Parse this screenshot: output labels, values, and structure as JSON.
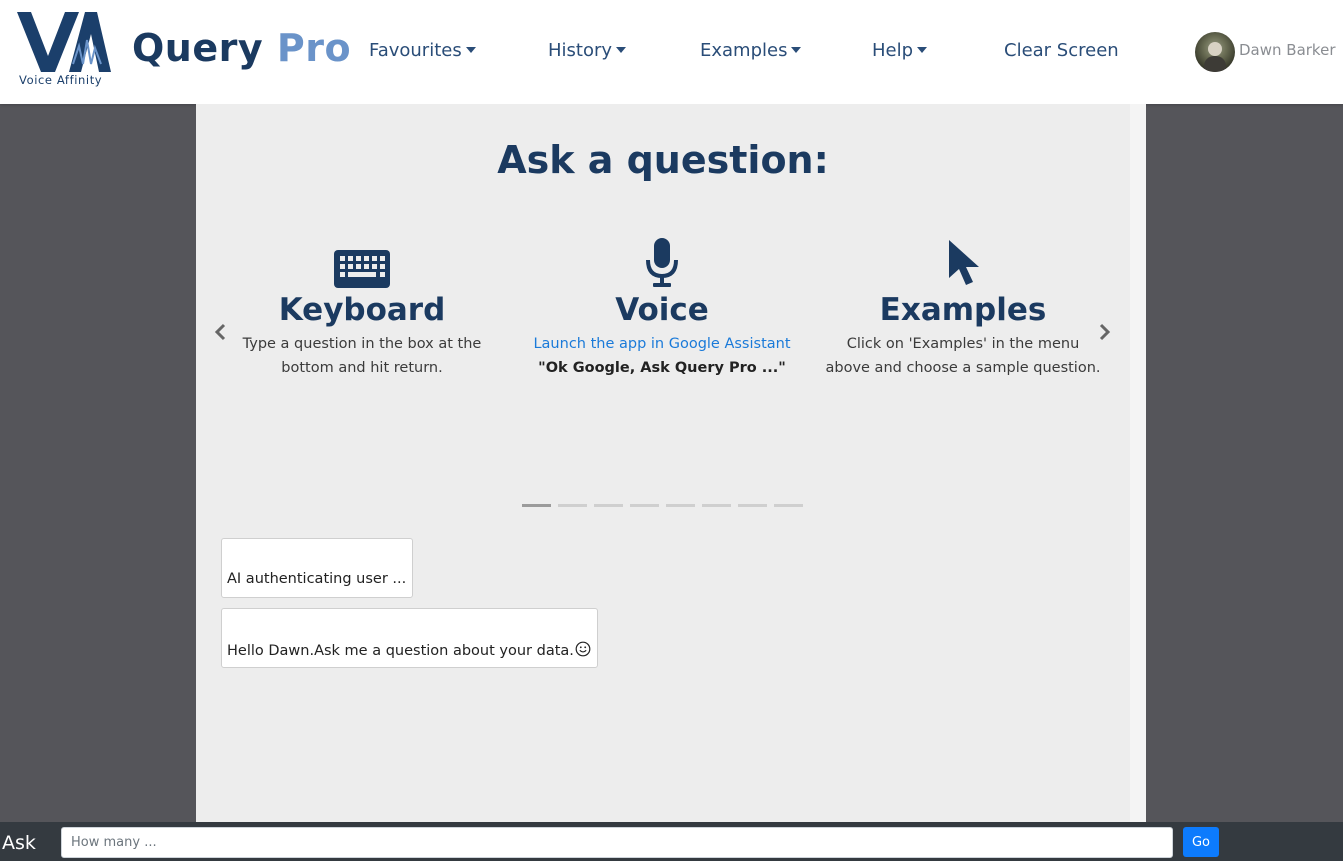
{
  "brand": {
    "logo_mark": "VA",
    "logo_tagline": "Voice Affinity",
    "name_primary": "Query",
    "name_secondary": "Pro",
    "colors": {
      "primary": "#1b3a60",
      "accent": "#6a93c9"
    }
  },
  "nav": {
    "items": [
      {
        "label": "Favourites",
        "dropdown": true
      },
      {
        "label": "History",
        "dropdown": true
      },
      {
        "label": "Examples",
        "dropdown": true
      },
      {
        "label": "Help",
        "dropdown": true
      },
      {
        "label": "Clear Screen",
        "dropdown": false
      }
    ]
  },
  "user": {
    "name": "Dawn Barker",
    "avatar_icon": "user-avatar-photo"
  },
  "main": {
    "title": "Ask a question:",
    "cards": [
      {
        "icon": "keyboard-icon",
        "title": "Keyboard",
        "line1": "Type a question in the box at the",
        "line2": "bottom and hit return."
      },
      {
        "icon": "microphone-icon",
        "title": "Voice",
        "link": "Launch the app in Google Assistant",
        "quote": "\"Ok Google, Ask Query Pro ...\""
      },
      {
        "icon": "pointer-icon",
        "title": "Examples",
        "line1": "Click on 'Examples' in the menu",
        "line2": "above and choose a sample question."
      }
    ],
    "carousel": {
      "slide_count": 8,
      "active_index": 0
    },
    "messages": [
      {
        "text": "AI authenticating user ..."
      },
      {
        "text": "Hello Dawn.Ask me a question about your data.",
        "emoji": "smiley-icon"
      }
    ]
  },
  "bottom": {
    "ask_label": "Ask",
    "input_placeholder": "How many ...",
    "input_value": "",
    "go_label": "Go",
    "go_color": "#0d7bfd"
  }
}
